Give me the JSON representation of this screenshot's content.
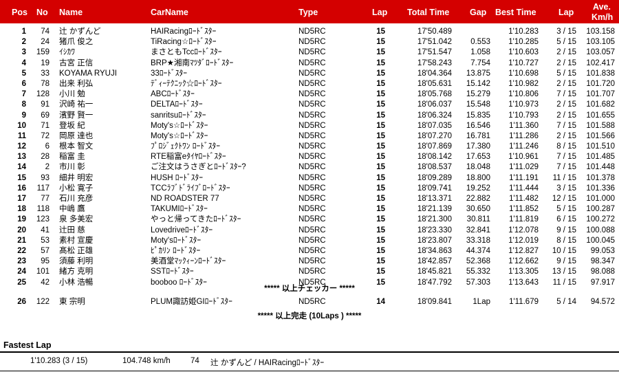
{
  "header": {
    "pos": "Pos",
    "no": "No",
    "name": "Name",
    "carname": "CarName",
    "type": "Type",
    "lap": "Lap",
    "total_time": "Total Time",
    "gap": "Gap",
    "best_time": "Best Time",
    "best_lap": "Lap",
    "ave1": "Ave.",
    "ave2": "Km/h"
  },
  "rows": [
    {
      "pos": "1",
      "no": "74",
      "name": "辻 かずんど",
      "car": "HAIRacingﾛｰﾄﾞｽﾀｰ",
      "type": "ND5RC",
      "lap": "15",
      "total": "17'50.489",
      "gap": "",
      "best": "1'10.283",
      "blap": "3 / 15",
      "ave": "103.158"
    },
    {
      "pos": "2",
      "no": "24",
      "name": "猪爪 俊之",
      "car": "TiRacing☆ﾛｰﾄﾞｽﾀｰ",
      "type": "ND5RC",
      "lap": "15",
      "total": "17'51.042",
      "gap": "0.553",
      "best": "1'10.285",
      "blap": "5 / 15",
      "ave": "103.105"
    },
    {
      "pos": "3",
      "no": "159",
      "name": "ｲｼｶﾜ",
      "car": "まさともTccﾛｰﾄﾞｽﾀｰ",
      "type": "ND5RC",
      "lap": "15",
      "total": "17'51.547",
      "gap": "1.058",
      "best": "1'10.603",
      "blap": "2 / 15",
      "ave": "103.057"
    },
    {
      "pos": "4",
      "no": "19",
      "name": "古宮 正信",
      "car": "BRP★湘南ﾏﾂﾀﾞﾛｰﾄﾞｽﾀｰ",
      "type": "ND5RC",
      "lap": "15",
      "total": "17'58.243",
      "gap": "7.754",
      "best": "1'10.727",
      "blap": "2 / 15",
      "ave": "102.417"
    },
    {
      "pos": "5",
      "no": "33",
      "name": "KOYAMA RYUJI",
      "car": "33ﾛｰﾄﾞｽﾀｰ",
      "type": "ND5RC",
      "lap": "15",
      "total": "18'04.364",
      "gap": "13.875",
      "best": "1'10.698",
      "blap": "5 / 15",
      "ave": "101.838"
    },
    {
      "pos": "6",
      "no": "78",
      "name": "出来 利弘",
      "car": "ﾃﾞｨｰﾃｸﾆｯｸ☆ﾛｰﾄﾞｽﾀｰ",
      "type": "ND5RC",
      "lap": "15",
      "total": "18'05.631",
      "gap": "15.142",
      "best": "1'10.982",
      "blap": "2 / 15",
      "ave": "101.720"
    },
    {
      "pos": "7",
      "no": "128",
      "name": "小川 勉",
      "car": "ABCﾛｰﾄﾞｽﾀｰ",
      "type": "ND5RC",
      "lap": "15",
      "total": "18'05.768",
      "gap": "15.279",
      "best": "1'10.806",
      "blap": "7 / 15",
      "ave": "101.707"
    },
    {
      "pos": "8",
      "no": "91",
      "name": "沢崎 祐一",
      "car": "DELTAﾛｰﾄﾞｽﾀｰ",
      "type": "ND5RC",
      "lap": "15",
      "total": "18'06.037",
      "gap": "15.548",
      "best": "1'10.973",
      "blap": "2 / 15",
      "ave": "101.682"
    },
    {
      "pos": "9",
      "no": "69",
      "name": "濱野 賢一",
      "car": "sanritsuﾛｰﾄﾞｽﾀｰ",
      "type": "ND5RC",
      "lap": "15",
      "total": "18'06.324",
      "gap": "15.835",
      "best": "1'10.793",
      "blap": "2 / 15",
      "ave": "101.655"
    },
    {
      "pos": "10",
      "no": "71",
      "name": "登坂 紀",
      "car": "Moty's☆ﾛｰﾄﾞｽﾀｰ",
      "type": "ND5RC",
      "lap": "15",
      "total": "18'07.035",
      "gap": "16.546",
      "best": "1'11.360",
      "blap": "7 / 15",
      "ave": "101.588"
    },
    {
      "pos": "11",
      "no": "72",
      "name": "岡原 達也",
      "car": "Moty's☆ﾛｰﾄﾞｽﾀｰ",
      "type": "ND5RC",
      "lap": "15",
      "total": "18'07.270",
      "gap": "16.781",
      "best": "1'11.286",
      "blap": "2 / 15",
      "ave": "101.566"
    },
    {
      "pos": "12",
      "no": "6",
      "name": "根本 智文",
      "car": "ﾌﾟﾛｼﾞｪｸﾄﾜﾝ ﾛｰﾄﾞｽﾀｰ",
      "type": "ND5RC",
      "lap": "15",
      "total": "18'07.869",
      "gap": "17.380",
      "best": "1'11.246",
      "blap": "8 / 15",
      "ave": "101.510"
    },
    {
      "pos": "13",
      "no": "28",
      "name": "稲富 圭",
      "car": "RTE稲富eﾀｲﾔﾛｰﾄﾞｽﾀｰ",
      "type": "ND5RC",
      "lap": "15",
      "total": "18'08.142",
      "gap": "17.653",
      "best": "1'10.961",
      "blap": "7 / 15",
      "ave": "101.485"
    },
    {
      "pos": "14",
      "no": "2",
      "name": "市川 彰",
      "car": "ご注文はうさぎとﾛｰﾄﾞｽﾀｰ?",
      "type": "ND5RC",
      "lap": "15",
      "total": "18'08.537",
      "gap": "18.048",
      "best": "1'11.029",
      "blap": "7 / 15",
      "ave": "101.448"
    },
    {
      "pos": "15",
      "no": "93",
      "name": "細井 明宏",
      "car": "HUSH ﾛｰﾄﾞｽﾀｰ",
      "type": "ND5RC",
      "lap": "15",
      "total": "18'09.289",
      "gap": "18.800",
      "best": "1'11.191",
      "blap": "11 / 15",
      "ave": "101.378"
    },
    {
      "pos": "16",
      "no": "117",
      "name": "小松 寛子",
      "car": "TCCﾗﾌﾞﾄﾞﾗｲﾌﾞﾛｰﾄﾞｽﾀｰ",
      "type": "ND5RC",
      "lap": "15",
      "total": "18'09.741",
      "gap": "19.252",
      "best": "1'11.444",
      "blap": "3 / 15",
      "ave": "101.336"
    },
    {
      "pos": "17",
      "no": "77",
      "name": "石川 充彦",
      "car": "ND ROADSTER 77",
      "type": "ND5RC",
      "lap": "15",
      "total": "18'13.371",
      "gap": "22.882",
      "best": "1'11.482",
      "blap": "12 / 15",
      "ave": "101.000"
    },
    {
      "pos": "18",
      "no": "118",
      "name": "中嶋 鷹",
      "car": "TAKUMIﾛｰﾄﾞｽﾀｰ",
      "type": "ND5RC",
      "lap": "15",
      "total": "18'21.139",
      "gap": "30.650",
      "best": "1'11.852",
      "blap": "5 / 15",
      "ave": "100.287"
    },
    {
      "pos": "19",
      "no": "123",
      "name": "泉 多美宏",
      "car": "やっと帰ってきたﾛｰﾄﾞｽﾀｰ",
      "type": "ND5RC",
      "lap": "15",
      "total": "18'21.300",
      "gap": "30.811",
      "best": "1'11.819",
      "blap": "6 / 15",
      "ave": "100.272"
    },
    {
      "pos": "20",
      "no": "41",
      "name": "辻田 慈",
      "car": "Lovedriveﾛｰﾄﾞｽﾀｰ",
      "type": "ND5RC",
      "lap": "15",
      "total": "18'23.330",
      "gap": "32.841",
      "best": "1'12.078",
      "blap": "9 / 15",
      "ave": "100.088"
    },
    {
      "pos": "21",
      "no": "53",
      "name": "素村 宣慶",
      "car": "Moty'sﾛｰﾄﾞｽﾀｰ",
      "type": "ND5RC",
      "lap": "15",
      "total": "18'23.807",
      "gap": "33.318",
      "best": "1'12.019",
      "blap": "8 / 15",
      "ave": "100.045"
    },
    {
      "pos": "22",
      "no": "57",
      "name": "髙松 正雄",
      "car": "ﾋﾟｶﾘﾝ ﾛｰﾄﾞｽﾀｰ",
      "type": "ND5RC",
      "lap": "15",
      "total": "18'34.863",
      "gap": "44.374",
      "best": "1'12.827",
      "blap": "10 / 15",
      "ave": "99.053"
    },
    {
      "pos": "23",
      "no": "95",
      "name": "須藤 利明",
      "car": "美酒堂ﾏｯｸｨｰﾝﾛｰﾄﾞｽﾀｰ",
      "type": "ND5RC",
      "lap": "15",
      "total": "18'42.857",
      "gap": "52.368",
      "best": "1'12.662",
      "blap": "9 / 15",
      "ave": "98.347"
    },
    {
      "pos": "24",
      "no": "101",
      "name": "緒方 克明",
      "car": "SSTﾛｰﾄﾞｽﾀｰ",
      "type": "ND5RC",
      "lap": "15",
      "total": "18'45.821",
      "gap": "55.332",
      "best": "1'13.305",
      "blap": "13 / 15",
      "ave": "98.088"
    },
    {
      "pos": "25",
      "no": "42",
      "name": "小林 浩暢",
      "car": "booboo ﾛｰﾄﾞｽﾀｰ",
      "type": "ND5RC",
      "lap": "15",
      "total": "18'47.792",
      "gap": "57.303",
      "best": "1'13.643",
      "blap": "11 / 15",
      "ave": "97.917"
    }
  ],
  "checker_note": "***** 以上チェッカー *****",
  "row26": {
    "pos": "26",
    "no": "122",
    "name": "東 宗明",
    "car": "PLUM諏訪姫GIﾛｰﾄﾞｽﾀｰ",
    "type": "ND5RC",
    "lap": "14",
    "total": "18'09.841",
    "gap": "1Lap",
    "best": "1'11.679",
    "blap": "5 / 14",
    "ave": "94.572"
  },
  "finish_note": "***** 以上完走 (10Laps ) *****",
  "fastest": {
    "title": "Fastest Lap",
    "time": "1'10.283 (3 / 15)",
    "speed": "104.748 km/h",
    "no": "74",
    "driver": "辻 かずんど / HAIRacingﾛｰﾄﾞｽﾀｰ"
  }
}
